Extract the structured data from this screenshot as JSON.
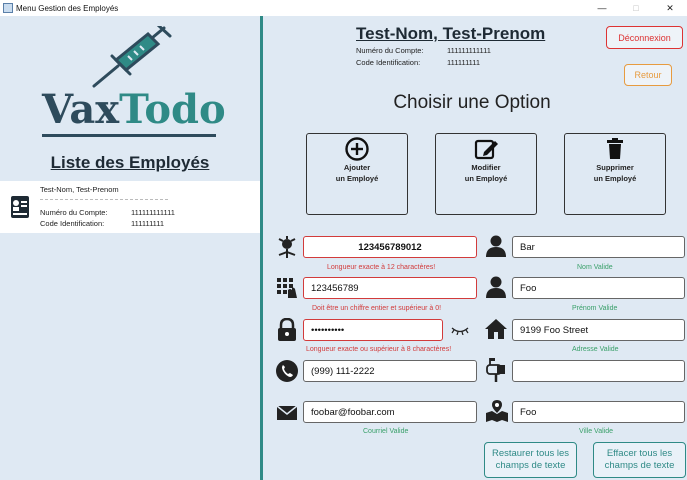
{
  "window": {
    "title": "Menu Gestion des Employés",
    "minimize": "—",
    "maximize": "□",
    "close": "✕"
  },
  "logo": {
    "vax": "Vax",
    "todo": "Todo"
  },
  "employees": {
    "title": "Liste des Employés",
    "items": [
      {
        "name": "Test-Nom, Test-Prenom",
        "account_label": "Numéro du Compte:",
        "account_value": "111111111111",
        "id_label": "Code Identification:",
        "id_value": "111111111"
      }
    ]
  },
  "header": {
    "name": "Test-Nom, Test-Prenom",
    "account_label": "Numéro du Compte:",
    "account_value": "111111111111",
    "id_label": "Code Identification:",
    "id_value": "111111111",
    "logout": "Déconnexion",
    "back": "Retour"
  },
  "options": {
    "title": "Choisir une Option",
    "add": {
      "line1": "Ajouter",
      "line2": "un Employé"
    },
    "edit": {
      "line1": "Modifier",
      "line2": "un Employé"
    },
    "delete": {
      "line1": "Supprimer",
      "line2": "un Employé"
    }
  },
  "form": {
    "account": {
      "value": "123456789012",
      "message": "Longueur exacte à 12 charactères!"
    },
    "code": {
      "value": "123456789",
      "message": "Doit être un chiffre entier et supérieur à 0!"
    },
    "password": {
      "value": "••••••••••",
      "message": "Longueur exacte ou supérieur à 8 charactères!"
    },
    "phone": {
      "value": "(999) 111-2222"
    },
    "email": {
      "value": "foobar@foobar.com",
      "message": "Courriel Valide"
    },
    "last_name": {
      "value": "Bar",
      "message": "Nom Valide"
    },
    "first_name": {
      "value": "Foo",
      "message": "Prénom Valide"
    },
    "address": {
      "value": "9199 Foo Street",
      "message": "Adresse Valide"
    },
    "postal": {
      "value": ""
    },
    "city": {
      "value": "Foo",
      "message": "Ville Valide"
    }
  },
  "actions": {
    "restore_line1": "Restaurer tous les",
    "restore_line2": "champs de texte",
    "clear_line1": "Effacer tous les",
    "clear_line2": "champs de texte"
  },
  "colors": {
    "accent": "#2f8a86",
    "error": "#d23b3b",
    "valid": "#3aa06a",
    "warning": "#e79b3f",
    "dark": "#2e4b5c"
  }
}
